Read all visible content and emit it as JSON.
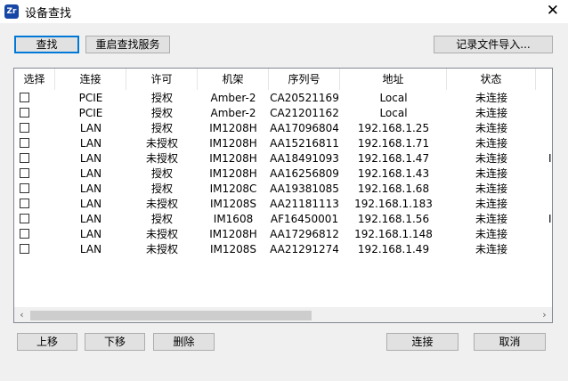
{
  "window": {
    "title": "设备查找",
    "app_icon_text": "Zr",
    "close_glyph": "✕"
  },
  "toolbar": {
    "search": "查找",
    "restart": "重启查找服务",
    "import": "记录文件导入..."
  },
  "table": {
    "columns": [
      "选择",
      "连接",
      "许可",
      "机架",
      "序列号",
      "地址",
      "状态"
    ],
    "rows": [
      [
        "PCIE",
        "授权",
        "Amber-2",
        "CA20521169",
        "Local",
        "未连接",
        ""
      ],
      [
        "PCIE",
        "授权",
        "Amber-2",
        "CA21201162",
        "Local",
        "未连接",
        ""
      ],
      [
        "LAN",
        "授权",
        "IM1208H",
        "AA17096804",
        "192.168.1.25",
        "未连接",
        ""
      ],
      [
        "LAN",
        "未授权",
        "IM1208H",
        "AA15216811",
        "192.168.1.71",
        "未连接",
        ""
      ],
      [
        "LAN",
        "未授权",
        "IM1208H",
        "AA18491093",
        "192.168.1.47",
        "未连接",
        "I"
      ],
      [
        "LAN",
        "授权",
        "IM1208H",
        "AA16256809",
        "192.168.1.43",
        "未连接",
        ""
      ],
      [
        "LAN",
        "授权",
        "IM1208C",
        "AA19381085",
        "192.168.1.68",
        "未连接",
        ""
      ],
      [
        "LAN",
        "未授权",
        "IM1208S",
        "AA21181113",
        "192.168.1.183",
        "未连接",
        ""
      ],
      [
        "LAN",
        "授权",
        "IM1608",
        "AF16450001",
        "192.168.1.56",
        "未连接",
        "I"
      ],
      [
        "LAN",
        "未授权",
        "IM1208H",
        "AA17296812",
        "192.168.1.148",
        "未连接",
        ""
      ],
      [
        "LAN",
        "未授权",
        "IM1208S",
        "AA21291274",
        "192.168.1.49",
        "未连接",
        ""
      ]
    ],
    "scroll_left": "‹",
    "scroll_right": "›"
  },
  "footer": {
    "up": "上移",
    "down": "下移",
    "delete": "删除",
    "connect": "连接",
    "cancel": "取消"
  }
}
